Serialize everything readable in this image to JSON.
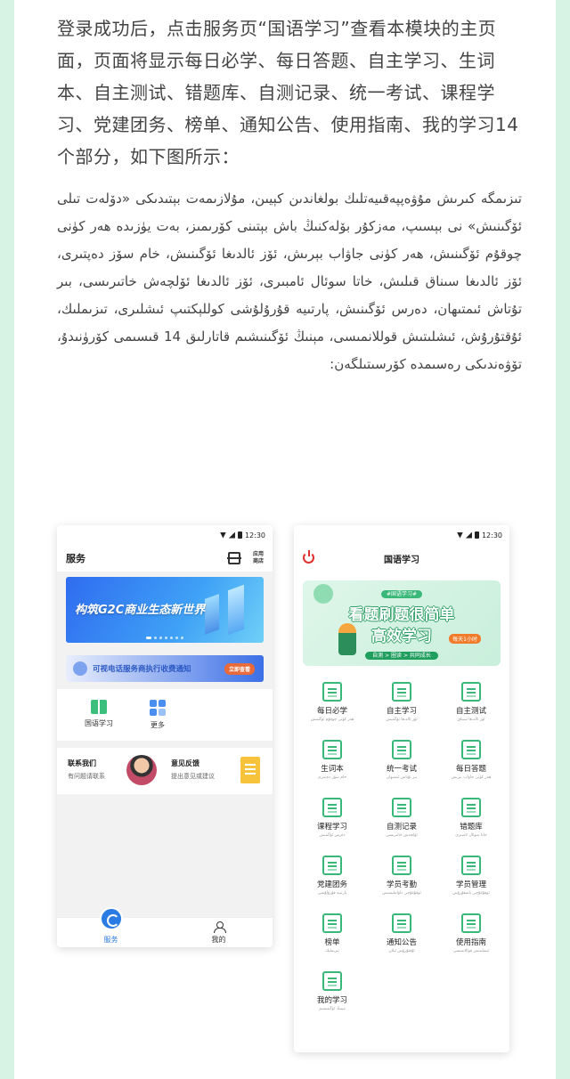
{
  "intro": {
    "chinese": "登录成功后，点击服务页“国语学习”查看本模块的主页面，页面将显示每日必学、每日答题、自主学习、生词本、自主测试、错题库、自测记录、统一考试、课程学习、党建团务、榜单、通知公告、使用指南、我的学习14个部分，如下图所示：",
    "uyghur": "تىزىمگە كىرىش مۇۋەپپەقىيەتلىك بولغاندىن كېيىن، مۇلازىمەت بېتىدىكى «دۆلەت تىلى ئۆگىنىش» نى بېسىپ، مەزكۇر بۆلەكنىڭ باش بېتىنى كۆرىمىز، بەت يۈزىدە ھەر كۈنى چوقۇم ئۆگىنىش، ھەر كۈنى جاۋاب بېرىش، ئۆز ئالدىغا ئۆگىنىش، خام سۆز دەپتىرى، ئۆز ئالدىغا سىناق قىلىش، خاتا سوئال ئامبىرى، ئۆز ئالدىغا ئۆلچەش خاتىرىسى، بىر تۇتاش ئىمتىھان، دەرس ئۆگىنىش، پارتىيە قۇرۇلۇشى كوللېكتىپ ئىشلىرى، تىزىملىك، ئۇقتۇرۇش، ئىشلىتىش قوللانمىسى، مېنىڭ ئۆگىنىشىم قاتارلىق 14 قىسىمى كۆرۈنىدۇ، تۆۋەندىكى رەسىمدە كۆرسىتىلگەن:"
  },
  "phone1": {
    "status_time": "12:30",
    "title": "服务",
    "store_label": "应用商店",
    "banner_text": "构筑G2C商业生态新世界",
    "notice_text": "可视电话服务商执行收费通知",
    "notice_btn": "立即查看",
    "apps": [
      {
        "label": "国语学习",
        "icon": "book-reader-icon"
      },
      {
        "label": "更多",
        "icon": "more-grid-icon"
      }
    ],
    "contact_title": "联系我们",
    "contact_sub": "有问题请联系",
    "feedback_title": "意见反馈",
    "feedback_sub": "提出意见或建议",
    "tabs": [
      {
        "label": "服务",
        "icon": "service-icon"
      },
      {
        "label": "我的",
        "icon": "user-icon"
      }
    ]
  },
  "phone2": {
    "status_time": "12:30",
    "title": "国语学习",
    "banner_tag": "#国语学习#",
    "banner_line1": "看题刷题很简单",
    "banner_line2": "高效学习",
    "banner_hour": "每天1小时",
    "banner_slogan": "自测 > 圈读 > 共同成长",
    "menu": [
      {
        "cn": "每日必学",
        "ug": "ھەر كۈنى چوقۇم ئۆگىنىش"
      },
      {
        "cn": "自主学习",
        "ug": "ئۆز ئالدىغا ئۆگىنىش"
      },
      {
        "cn": "自主测试",
        "ug": "ئۆز ئالدىغا سىناق"
      },
      {
        "cn": "生词本",
        "ug": "خام سۆز دەپتىرى"
      },
      {
        "cn": "统一考试",
        "ug": "بىر تۇتاش ئىمتىھان"
      },
      {
        "cn": "每日答题",
        "ug": "ھەر كۈنى جاۋاب بېرىش"
      },
      {
        "cn": "课程学习",
        "ug": "دەرس ئۆگىنىش"
      },
      {
        "cn": "自测记录",
        "ug": "ئۆلچەش خاتىرىسى"
      },
      {
        "cn": "错题库",
        "ug": "خاتا سوئال ئامبىرى"
      },
      {
        "cn": "党建团务",
        "ug": "پارتىيە قۇرۇلۇشى"
      },
      {
        "cn": "学员考勤",
        "ug": "ئوقۇغۇچى داۋاملىشىش"
      },
      {
        "cn": "学员管理",
        "ug": "ئوقۇغۇچى باشقۇرۇش"
      },
      {
        "cn": "榜单",
        "ug": "تىزىملىك"
      },
      {
        "cn": "通知公告",
        "ug": "ئۇقتۇرۇش ئېلان"
      },
      {
        "cn": "使用指南",
        "ug": "ئىشلىتىش قوللانمىسى"
      },
      {
        "cn": "我的学习",
        "ug": "مېنىڭ ئۆگىنىشىم"
      }
    ]
  },
  "colors": {
    "page_bg": "#d7f3e4",
    "accent_green": "#3ab87a",
    "accent_blue": "#2a7be4",
    "power_red": "#e0312c"
  }
}
